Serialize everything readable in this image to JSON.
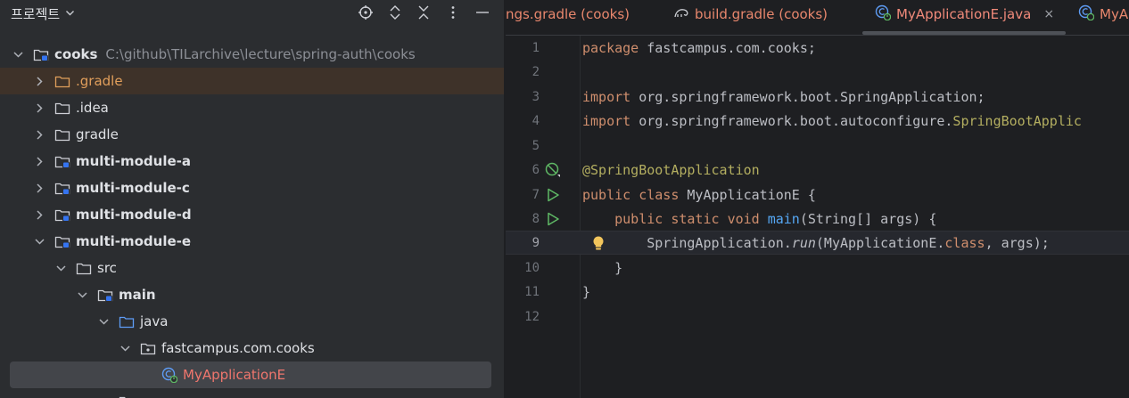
{
  "project_panel": {
    "title": "프로젝트",
    "tree": [
      {
        "label": "cooks",
        "hint": "C:\\github\\TILarchive\\lecture\\spring-auth\\cooks",
        "bold": true,
        "kind": "module",
        "expanded": true,
        "depth": 0
      },
      {
        "label": ".gradle",
        "kind": "folder-orange",
        "expanded": false,
        "depth": 1
      },
      {
        "label": ".idea",
        "kind": "folder",
        "expanded": false,
        "depth": 1
      },
      {
        "label": "gradle",
        "kind": "folder",
        "expanded": false,
        "depth": 1
      },
      {
        "label": "multi-module-a",
        "bold": true,
        "kind": "module",
        "expanded": false,
        "depth": 1
      },
      {
        "label": "multi-module-c",
        "bold": true,
        "kind": "module",
        "expanded": false,
        "depth": 1
      },
      {
        "label": "multi-module-d",
        "bold": true,
        "kind": "module",
        "expanded": false,
        "depth": 1
      },
      {
        "label": "multi-module-e",
        "bold": true,
        "kind": "module",
        "expanded": true,
        "depth": 1
      },
      {
        "label": "src",
        "kind": "folder",
        "expanded": true,
        "depth": 2
      },
      {
        "label": "main",
        "bold": true,
        "kind": "module",
        "expanded": true,
        "depth": 3
      },
      {
        "label": "java",
        "kind": "folder-blue",
        "expanded": true,
        "depth": 4
      },
      {
        "label": "fastcampus.com.cooks",
        "kind": "package",
        "expanded": true,
        "depth": 5
      },
      {
        "label": "MyApplicationE",
        "kind": "spring-class",
        "depth": 6
      }
    ]
  },
  "editor": {
    "tabs": [
      {
        "label": "ngs.gradle (cooks)"
      },
      {
        "label": "build.gradle (cooks)"
      },
      {
        "label": "MyApplicationE.java",
        "close": "×"
      },
      {
        "label": "MyA"
      }
    ],
    "current_line": 9,
    "lines": [
      {
        "n": "1",
        "code": "package fastcampus.com.cooks;"
      },
      {
        "n": "2",
        "code": ""
      },
      {
        "n": "3",
        "code": "import org.springframework.boot.SpringApplication;"
      },
      {
        "n": "4",
        "code": "import org.springframework.boot.autoconfigure.SpringBootApplic"
      },
      {
        "n": "5",
        "code": ""
      },
      {
        "n": "6",
        "code": "@SpringBootApplication"
      },
      {
        "n": "7",
        "code": "public class MyApplicationE {"
      },
      {
        "n": "8",
        "code": "    public static void main(String[] args) {"
      },
      {
        "n": "9",
        "code": "        SpringApplication.run(MyApplicationE.class, args);"
      },
      {
        "n": "10",
        "code": "    }"
      },
      {
        "n": "11",
        "code": "}"
      },
      {
        "n": "12",
        "code": ""
      }
    ]
  },
  "colors": {
    "panel_bg": "#2b2d30",
    "editor_bg": "#1e1f22",
    "keyword": "#cf8e6d",
    "annotation": "#b3ae60",
    "method": "#56a8f5",
    "run_green": "#5fb865",
    "tab_text": "#e8876d"
  }
}
